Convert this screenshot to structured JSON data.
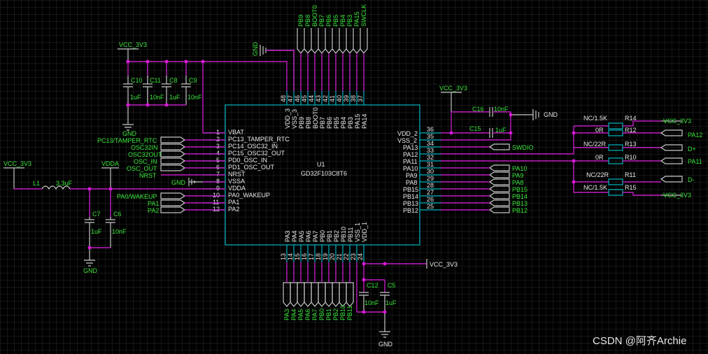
{
  "chip": {
    "designator": "U1",
    "part": "GD32F103C8T6"
  },
  "power": {
    "vcc3v3": "VCC_3V3",
    "gnd": "GND",
    "vdda": "VDDA"
  },
  "pins": {
    "left": [
      {
        "num": "1",
        "name": "VBAT"
      },
      {
        "num": "2",
        "name": "PC13_TAMPER_RTC"
      },
      {
        "num": "3",
        "name": "PC14_OSC32_IN"
      },
      {
        "num": "4",
        "name": "PC15_OSC32_OUT"
      },
      {
        "num": "5",
        "name": "PD0_OSC_IN"
      },
      {
        "num": "6",
        "name": "PD1_OSC_OUT"
      },
      {
        "num": "7",
        "name": "NRST"
      },
      {
        "num": "8",
        "name": "VSSA"
      },
      {
        "num": "9",
        "name": "VDDA"
      },
      {
        "num": "10",
        "name": "PA0_WAKEUP"
      },
      {
        "num": "11",
        "name": "PA1"
      },
      {
        "num": "12",
        "name": "PA2"
      }
    ],
    "right": [
      {
        "num": "36",
        "name": "VDD_2"
      },
      {
        "num": "35",
        "name": "VSS_2"
      },
      {
        "num": "34",
        "name": "PA13"
      },
      {
        "num": "33",
        "name": "PA12"
      },
      {
        "num": "32",
        "name": "PA11"
      },
      {
        "num": "31",
        "name": "PA10"
      },
      {
        "num": "30",
        "name": "PA9"
      },
      {
        "num": "29",
        "name": "PA8"
      },
      {
        "num": "28",
        "name": "PB15"
      },
      {
        "num": "27",
        "name": "PB14"
      },
      {
        "num": "26",
        "name": "PB13"
      },
      {
        "num": "25",
        "name": "PB12"
      }
    ],
    "top": [
      {
        "num": "48",
        "name": "VDD_3"
      },
      {
        "num": "47",
        "name": "VSS_3"
      },
      {
        "num": "46",
        "name": "PB9"
      },
      {
        "num": "45",
        "name": "PB8"
      },
      {
        "num": "44",
        "name": "BOOT0"
      },
      {
        "num": "43",
        "name": "PB7"
      },
      {
        "num": "42",
        "name": "PB6"
      },
      {
        "num": "41",
        "name": "PB5"
      },
      {
        "num": "40",
        "name": "PB4"
      },
      {
        "num": "39",
        "name": "PB3"
      },
      {
        "num": "38",
        "name": "PA15"
      },
      {
        "num": "37",
        "name": "PA14"
      }
    ],
    "bottom": [
      {
        "num": "13",
        "name": "PA3"
      },
      {
        "num": "14",
        "name": "PA4"
      },
      {
        "num": "15",
        "name": "PA5"
      },
      {
        "num": "16",
        "name": "PA6"
      },
      {
        "num": "17",
        "name": "PA7"
      },
      {
        "num": "18",
        "name": "PB0"
      },
      {
        "num": "19",
        "name": "PB1"
      },
      {
        "num": "20",
        "name": "PB2"
      },
      {
        "num": "21",
        "name": "PB10"
      },
      {
        "num": "22",
        "name": "PB11"
      },
      {
        "num": "23",
        "name": "VSS_1"
      },
      {
        "num": "24",
        "name": "VDD_1"
      }
    ]
  },
  "nets": {
    "top": [
      "PB9",
      "PB8",
      "BOOT0",
      "PB7",
      "PB6",
      "PB5",
      "PB4",
      "PB3",
      "PA15",
      "SWCLK"
    ],
    "left": [
      "PC13/TAMPER_RTC",
      "OSC32IN",
      "OSC32OUT",
      "OSC_IN",
      "OSC_OUT",
      "NRST",
      "PA0/WAKEUP",
      "PA1",
      "PA2"
    ],
    "right": [
      "PA10",
      "PA9",
      "PA8",
      "PB15",
      "PB14",
      "PB13",
      "PB12"
    ],
    "bottom": [
      "PA3",
      "PA4",
      "PA5",
      "PA6",
      "PA7",
      "PB0",
      "PB1",
      "PB2",
      "PB10",
      "PB11"
    ],
    "swdio": "SWDIO",
    "res": [
      "VCC_3V3",
      "PA12",
      "D+",
      "PA11",
      "D-",
      "VCC_3V3"
    ]
  },
  "caps": {
    "c10": {
      "ref": "C10",
      "val": "1uF"
    },
    "c11": {
      "ref": "C11",
      "val": "10nF"
    },
    "c8": {
      "ref": "C8",
      "val": "1uF"
    },
    "c9": {
      "ref": "C9",
      "val": "10nF"
    },
    "c7": {
      "ref": "C7",
      "val": "1uF"
    },
    "c6": {
      "ref": "C6",
      "val": "10nF"
    },
    "c16": {
      "ref": "C16",
      "val": "10nF"
    },
    "c15": {
      "ref": "C15",
      "val": "1uF"
    },
    "c12": {
      "ref": "C12",
      "val": "10nF"
    },
    "c5": {
      "ref": "C5",
      "val": "1uF"
    }
  },
  "inductor": {
    "ref": "L1",
    "val": "3.3uF"
  },
  "resistors": {
    "r14": {
      "ref": "R14",
      "val": "NC/1.5K"
    },
    "r12": {
      "ref": "R12",
      "val": "0R"
    },
    "r13": {
      "ref": "R13",
      "val": "NC/22R"
    },
    "r10": {
      "ref": "R10",
      "val": "0R"
    },
    "r11": {
      "ref": "R11",
      "val": "NC/22R"
    },
    "r15": {
      "ref": "R15",
      "val": "NC/1.5K"
    }
  },
  "colors": {
    "background": "#000000",
    "wire": "#c21dc2",
    "component": "#00b7c3",
    "net_label": "#39e639",
    "text": "#e8e8e8"
  },
  "watermark": "CSDN @阿齐Archie"
}
